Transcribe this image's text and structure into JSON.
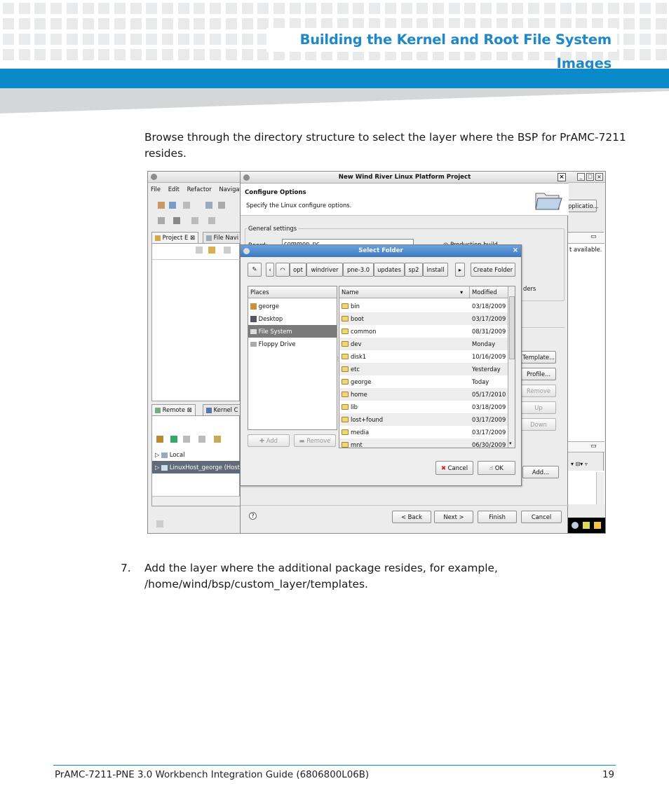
{
  "header": {
    "title": "Building the Kernel and Root File System Images"
  },
  "body": {
    "intro": "Browse through the directory structure to select the layer where the BSP for PrAMC-7211 resides.",
    "step_number": "7.",
    "step_line1": "Add the layer where the additional package resides, for example,",
    "step_line2": "/home/wind/bsp/custom_layer/templates."
  },
  "footer": {
    "left": "PrAMC-7211-PNE 3.0  Workbench Integration Guide (6806800L06B)",
    "page": "19"
  },
  "screenshot": {
    "eclipse": {
      "menu": [
        "File",
        "Edit",
        "Refactor",
        "Navigate"
      ],
      "tab_project": "Project E",
      "tab_file_nav": "File Navi",
      "tab_remote": "Remote",
      "tab_kernel": "Kernel C",
      "tree_local": "Local",
      "tree_host": "LinuxHost_george (Host",
      "right_btn": "pplicatio...",
      "right_text": "t available.",
      "right_ders": "ders"
    },
    "wizard": {
      "title": "New Wind River Linux Platform Project",
      "heading": "Configure Options",
      "subheading": "Specify the Linux configure options.",
      "group_label": "General settings",
      "board_label": "Board:",
      "board_value": "common_pc",
      "production_build": "Production build",
      "side_buttons": [
        "Template...",
        "Profile...",
        "Remove",
        "Up",
        "Down"
      ],
      "add_button": "Add...",
      "bottom_buttons": [
        "< Back",
        "Next >",
        "Finish",
        "Cancel"
      ]
    },
    "select_folder": {
      "title": "Select Folder",
      "path": [
        "opt",
        "windriver",
        "pne-3.0",
        "updates",
        "sp2",
        "install"
      ],
      "create_folder": "Create Folder",
      "places_header": "Places",
      "places": [
        "george",
        "Desktop",
        "File System",
        "Floppy Drive"
      ],
      "name_header": "Name",
      "modified_header": "Modified",
      "files": [
        {
          "name": "bin",
          "modified": "03/18/2009"
        },
        {
          "name": "boot",
          "modified": "03/17/2009"
        },
        {
          "name": "common",
          "modified": "08/31/2009"
        },
        {
          "name": "dev",
          "modified": "Monday"
        },
        {
          "name": "disk1",
          "modified": "10/16/2009"
        },
        {
          "name": "etc",
          "modified": "Yesterday"
        },
        {
          "name": "george",
          "modified": "Today"
        },
        {
          "name": "home",
          "modified": "05/17/2010"
        },
        {
          "name": "lib",
          "modified": "03/18/2009"
        },
        {
          "name": "lost+found",
          "modified": "03/17/2009"
        },
        {
          "name": "media",
          "modified": "03/17/2009"
        },
        {
          "name": "mnt",
          "modified": "06/30/2009"
        }
      ],
      "add": "Add",
      "remove": "Remove",
      "cancel": "Cancel",
      "ok": "OK"
    }
  }
}
